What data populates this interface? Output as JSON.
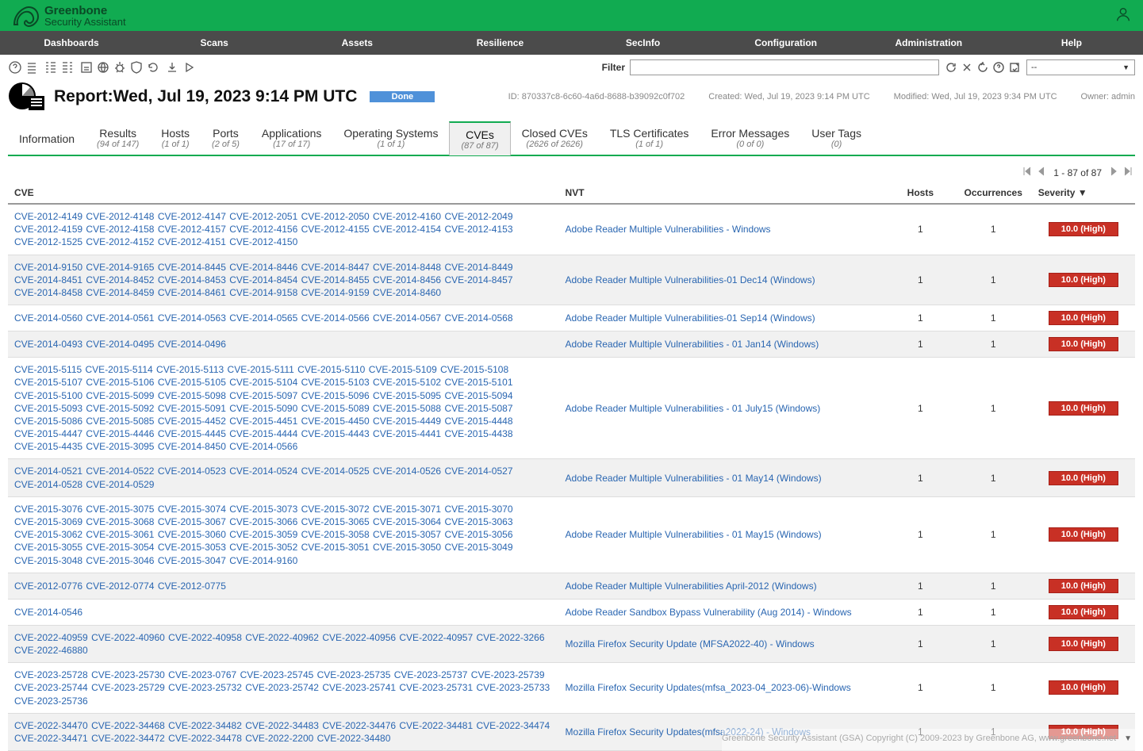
{
  "brand": {
    "line1": "Greenbone",
    "line2": "Security Assistant"
  },
  "nav": [
    "Dashboards",
    "Scans",
    "Assets",
    "Resilience",
    "SecInfo",
    "Configuration",
    "Administration",
    "Help"
  ],
  "filter": {
    "label": "Filter",
    "placeholder": "",
    "select": "--"
  },
  "report": {
    "title_prefix": "Report:",
    "title_date": "Wed, Jul 19, 2023 9:14 PM UTC",
    "status": "Done",
    "id": "ID: 870337c8-6c60-4a6d-8688-b39092c0f702",
    "created": "Created: Wed, Jul 19, 2023 9:14 PM UTC",
    "modified": "Modified: Wed, Jul 19, 2023 9:34 PM UTC",
    "owner": "Owner: admin"
  },
  "tabs": [
    {
      "label": "Information",
      "sub": ""
    },
    {
      "label": "Results",
      "sub": "(94 of 147)"
    },
    {
      "label": "Hosts",
      "sub": "(1 of 1)"
    },
    {
      "label": "Ports",
      "sub": "(2 of 5)"
    },
    {
      "label": "Applications",
      "sub": "(17 of 17)"
    },
    {
      "label": "Operating Systems",
      "sub": "(1 of 1)"
    },
    {
      "label": "CVEs",
      "sub": "(87 of 87)",
      "active": true
    },
    {
      "label": "Closed CVEs",
      "sub": "(2626 of 2626)"
    },
    {
      "label": "TLS Certificates",
      "sub": "(1 of 1)"
    },
    {
      "label": "Error Messages",
      "sub": "(0 of 0)"
    },
    {
      "label": "User Tags",
      "sub": "(0)"
    }
  ],
  "pager": {
    "text": "1 - 87 of 87"
  },
  "columns": {
    "cve": "CVE",
    "nvt": "NVT",
    "hosts": "Hosts",
    "occ": "Occurrences",
    "sev": "Severity ▼"
  },
  "rows": [
    {
      "cves": [
        "CVE-2012-4149",
        "CVE-2012-4148",
        "CVE-2012-4147",
        "CVE-2012-2051",
        "CVE-2012-2050",
        "CVE-2012-4160",
        "CVE-2012-2049",
        "CVE-2012-4159",
        "CVE-2012-4158",
        "CVE-2012-4157",
        "CVE-2012-4156",
        "CVE-2012-4155",
        "CVE-2012-4154",
        "CVE-2012-4153",
        "CVE-2012-1525",
        "CVE-2012-4152",
        "CVE-2012-4151",
        "CVE-2012-4150"
      ],
      "nvt": "Adobe Reader Multiple Vulnerabilities - Windows",
      "hosts": 1,
      "occ": 1,
      "sev": "10.0 (High)"
    },
    {
      "cves": [
        "CVE-2014-9150",
        "CVE-2014-9165",
        "CVE-2014-8445",
        "CVE-2014-8446",
        "CVE-2014-8447",
        "CVE-2014-8448",
        "CVE-2014-8449",
        "CVE-2014-8451",
        "CVE-2014-8452",
        "CVE-2014-8453",
        "CVE-2014-8454",
        "CVE-2014-8455",
        "CVE-2014-8456",
        "CVE-2014-8457",
        "CVE-2014-8458",
        "CVE-2014-8459",
        "CVE-2014-8461",
        "CVE-2014-9158",
        "CVE-2014-9159",
        "CVE-2014-8460"
      ],
      "nvt": "Adobe Reader Multiple Vulnerabilities-01 Dec14 (Windows)",
      "hosts": 1,
      "occ": 1,
      "sev": "10.0 (High)"
    },
    {
      "cves": [
        "CVE-2014-0560",
        "CVE-2014-0561",
        "CVE-2014-0563",
        "CVE-2014-0565",
        "CVE-2014-0566",
        "CVE-2014-0567",
        "CVE-2014-0568"
      ],
      "nvt": "Adobe Reader Multiple Vulnerabilities-01 Sep14 (Windows)",
      "hosts": 1,
      "occ": 1,
      "sev": "10.0 (High)"
    },
    {
      "cves": [
        "CVE-2014-0493",
        "CVE-2014-0495",
        "CVE-2014-0496"
      ],
      "nvt": "Adobe Reader Multiple Vulnerabilities - 01 Jan14 (Windows)",
      "hosts": 1,
      "occ": 1,
      "sev": "10.0 (High)"
    },
    {
      "cves": [
        "CVE-2015-5115",
        "CVE-2015-5114",
        "CVE-2015-5113",
        "CVE-2015-5111",
        "CVE-2015-5110",
        "CVE-2015-5109",
        "CVE-2015-5108",
        "CVE-2015-5107",
        "CVE-2015-5106",
        "CVE-2015-5105",
        "CVE-2015-5104",
        "CVE-2015-5103",
        "CVE-2015-5102",
        "CVE-2015-5101",
        "CVE-2015-5100",
        "CVE-2015-5099",
        "CVE-2015-5098",
        "CVE-2015-5097",
        "CVE-2015-5096",
        "CVE-2015-5095",
        "CVE-2015-5094",
        "CVE-2015-5093",
        "CVE-2015-5092",
        "CVE-2015-5091",
        "CVE-2015-5090",
        "CVE-2015-5089",
        "CVE-2015-5088",
        "CVE-2015-5087",
        "CVE-2015-5086",
        "CVE-2015-5085",
        "CVE-2015-4452",
        "CVE-2015-4451",
        "CVE-2015-4450",
        "CVE-2015-4449",
        "CVE-2015-4448",
        "CVE-2015-4447",
        "CVE-2015-4446",
        "CVE-2015-4445",
        "CVE-2015-4444",
        "CVE-2015-4443",
        "CVE-2015-4441",
        "CVE-2015-4438",
        "CVE-2015-4435",
        "CVE-2015-3095",
        "CVE-2014-8450",
        "CVE-2014-0566"
      ],
      "nvt": "Adobe Reader Multiple Vulnerabilities - 01 July15 (Windows)",
      "hosts": 1,
      "occ": 1,
      "sev": "10.0 (High)"
    },
    {
      "cves": [
        "CVE-2014-0521",
        "CVE-2014-0522",
        "CVE-2014-0523",
        "CVE-2014-0524",
        "CVE-2014-0525",
        "CVE-2014-0526",
        "CVE-2014-0527",
        "CVE-2014-0528",
        "CVE-2014-0529"
      ],
      "nvt": "Adobe Reader Multiple Vulnerabilities - 01 May14 (Windows)",
      "hosts": 1,
      "occ": 1,
      "sev": "10.0 (High)"
    },
    {
      "cves": [
        "CVE-2015-3076",
        "CVE-2015-3075",
        "CVE-2015-3074",
        "CVE-2015-3073",
        "CVE-2015-3072",
        "CVE-2015-3071",
        "CVE-2015-3070",
        "CVE-2015-3069",
        "CVE-2015-3068",
        "CVE-2015-3067",
        "CVE-2015-3066",
        "CVE-2015-3065",
        "CVE-2015-3064",
        "CVE-2015-3063",
        "CVE-2015-3062",
        "CVE-2015-3061",
        "CVE-2015-3060",
        "CVE-2015-3059",
        "CVE-2015-3058",
        "CVE-2015-3057",
        "CVE-2015-3056",
        "CVE-2015-3055",
        "CVE-2015-3054",
        "CVE-2015-3053",
        "CVE-2015-3052",
        "CVE-2015-3051",
        "CVE-2015-3050",
        "CVE-2015-3049",
        "CVE-2015-3048",
        "CVE-2015-3046",
        "CVE-2015-3047",
        "CVE-2014-9160"
      ],
      "nvt": "Adobe Reader Multiple Vulnerabilities - 01 May15 (Windows)",
      "hosts": 1,
      "occ": 1,
      "sev": "10.0 (High)"
    },
    {
      "cves": [
        "CVE-2012-0776",
        "CVE-2012-0774",
        "CVE-2012-0775"
      ],
      "nvt": "Adobe Reader Multiple Vulnerabilities April-2012 (Windows)",
      "hosts": 1,
      "occ": 1,
      "sev": "10.0 (High)"
    },
    {
      "cves": [
        "CVE-2014-0546"
      ],
      "nvt": "Adobe Reader Sandbox Bypass Vulnerability (Aug 2014) - Windows",
      "hosts": 1,
      "occ": 1,
      "sev": "10.0 (High)"
    },
    {
      "cves": [
        "CVE-2022-40959",
        "CVE-2022-40960",
        "CVE-2022-40958",
        "CVE-2022-40962",
        "CVE-2022-40956",
        "CVE-2022-40957",
        "CVE-2022-3266",
        "CVE-2022-46880"
      ],
      "nvt": "Mozilla Firefox Security Update (MFSA2022-40) - Windows",
      "hosts": 1,
      "occ": 1,
      "sev": "10.0 (High)"
    },
    {
      "cves": [
        "CVE-2023-25728",
        "CVE-2023-25730",
        "CVE-2023-0767",
        "CVE-2023-25745",
        "CVE-2023-25735",
        "CVE-2023-25737",
        "CVE-2023-25739",
        "CVE-2023-25744",
        "CVE-2023-25729",
        "CVE-2023-25732",
        "CVE-2023-25742",
        "CVE-2023-25741",
        "CVE-2023-25731",
        "CVE-2023-25733",
        "CVE-2023-25736"
      ],
      "nvt": "Mozilla Firefox Security Updates(mfsa_2023-04_2023-06)-Windows",
      "hosts": 1,
      "occ": 1,
      "sev": "10.0 (High)"
    },
    {
      "cves": [
        "CVE-2022-34470",
        "CVE-2022-34468",
        "CVE-2022-34482",
        "CVE-2022-34483",
        "CVE-2022-34476",
        "CVE-2022-34481",
        "CVE-2022-34474",
        "CVE-2022-34471",
        "CVE-2022-34472",
        "CVE-2022-34478",
        "CVE-2022-2200",
        "CVE-2022-34480"
      ],
      "nvt": "Mozilla Firefox Security Updates(mfsa2022-24) - Windows",
      "hosts": 1,
      "occ": 1,
      "sev": "10.0 (High)"
    }
  ],
  "footer": "Greenbone Security Assistant (GSA) Copyright (C) 2009-2023 by Greenbone AG, www.greenbone.net"
}
